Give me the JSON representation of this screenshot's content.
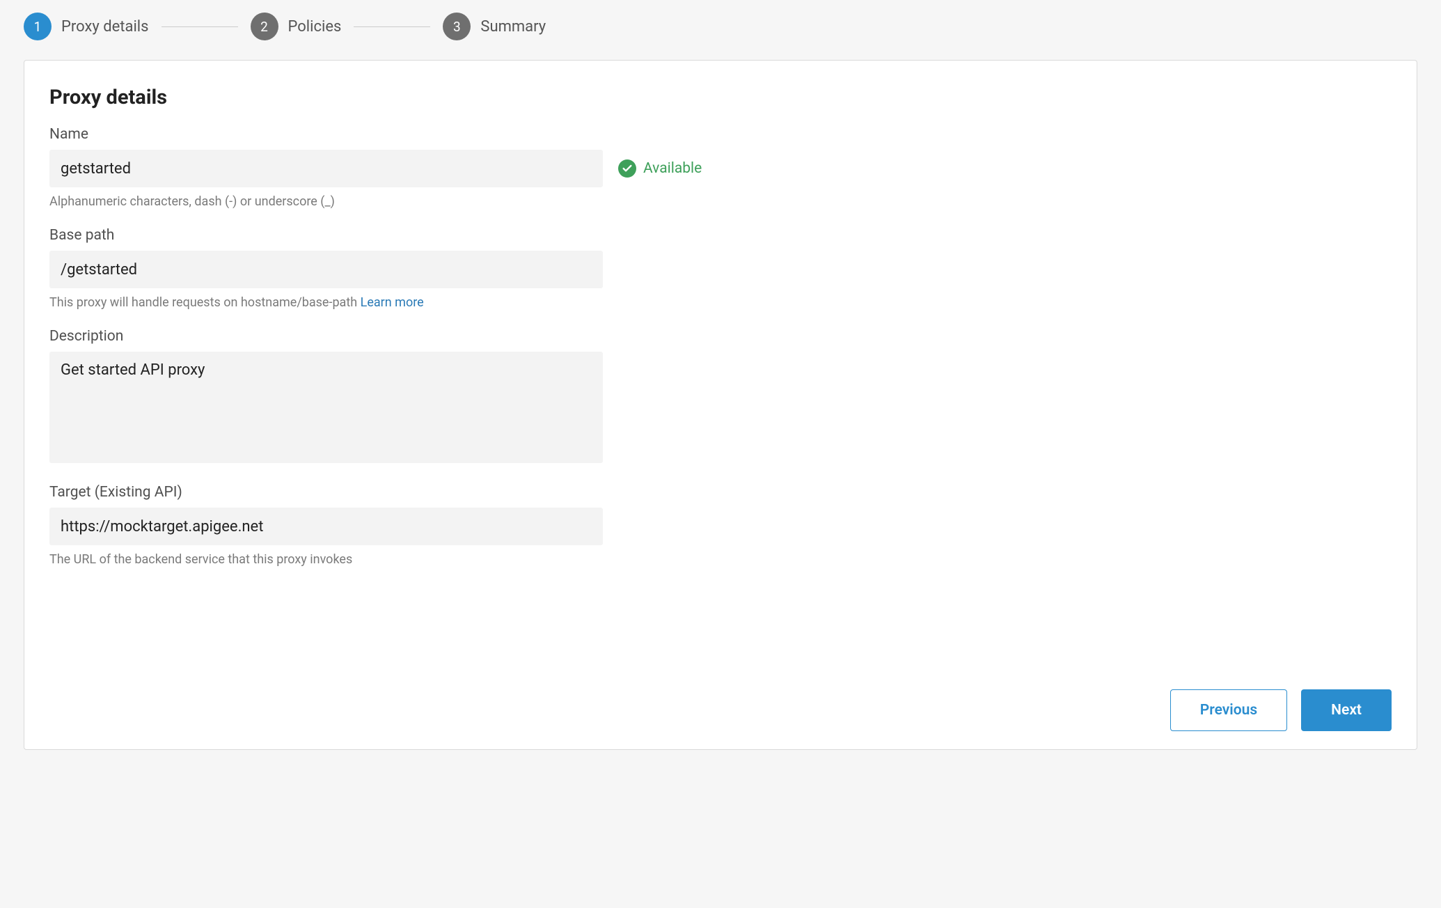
{
  "stepper": {
    "steps": [
      {
        "num": "1",
        "label": "Proxy details",
        "state": "active"
      },
      {
        "num": "2",
        "label": "Policies",
        "state": "inactive"
      },
      {
        "num": "3",
        "label": "Summary",
        "state": "inactive"
      }
    ]
  },
  "card": {
    "title": "Proxy details",
    "name": {
      "label": "Name",
      "value": "getstarted",
      "helper": "Alphanumeric characters, dash (-) or underscore (_)",
      "availability": "Available"
    },
    "base_path": {
      "label": "Base path",
      "value": "/getstarted",
      "helper": "This proxy will handle requests on hostname/base-path ",
      "learn_more": "Learn more"
    },
    "description": {
      "label": "Description",
      "value": "Get started API proxy"
    },
    "target": {
      "label": "Target (Existing API)",
      "value": "https://mocktarget.apigee.net",
      "helper": "The URL of the backend service that this proxy invokes"
    }
  },
  "footer": {
    "previous": "Previous",
    "next": "Next"
  },
  "colors": {
    "accent": "#2a8dcf",
    "success": "#3ea05a",
    "muted_bg": "#f3f3f3"
  }
}
